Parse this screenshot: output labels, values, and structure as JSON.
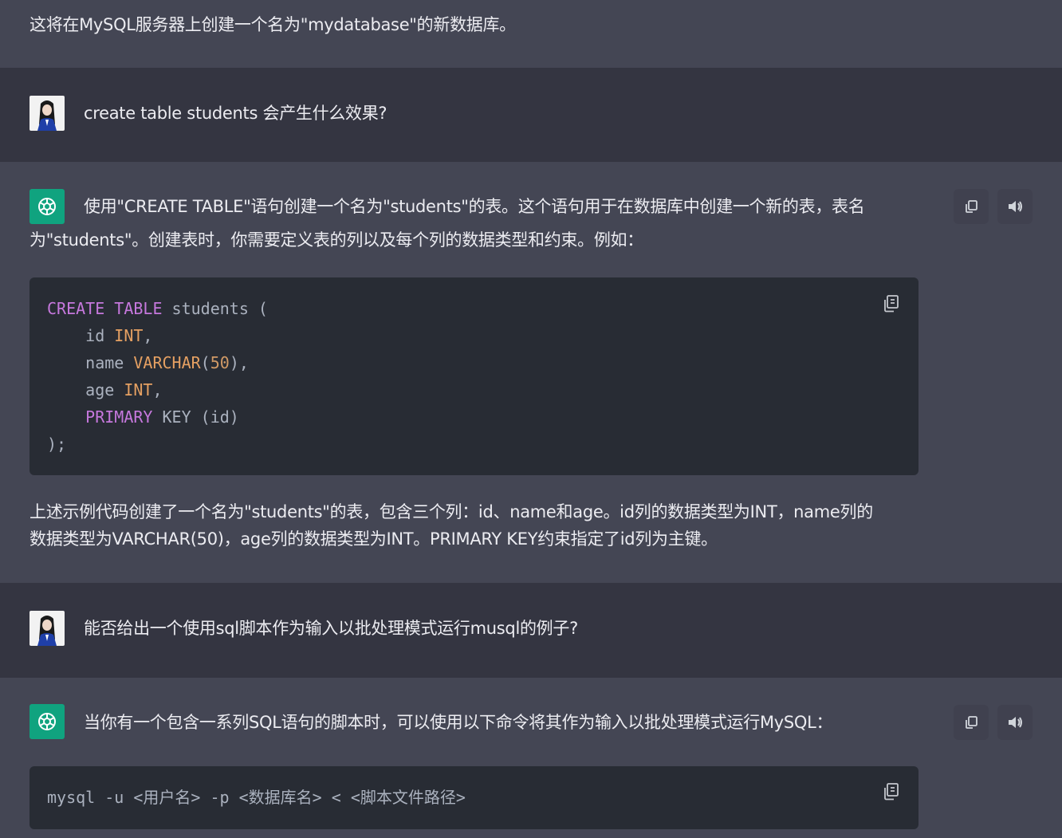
{
  "messages": {
    "m0": {
      "text": "这将在MySQL服务器上创建一个名为\"mydatabase\"的新数据库。"
    },
    "m1": {
      "text": "create table students 会产生什么效果?"
    },
    "m2": {
      "line1": "使用\"CREATE TABLE\"语句创建一个名为\"students\"的表。这个语句用于在数据库中创建一个新的表，表名",
      "line2": "为\"students\"。创建表时，你需要定义表的列以及每个列的数据类型和约束。例如：",
      "code": {
        "l1_kw1": "CREATE",
        "l1_kw2": "TABLE",
        "l1_rest": " students (",
        "l2_name": "    id ",
        "l2_type": "INT",
        "l2_end": ",",
        "l3_name": "    name ",
        "l3_type": "VARCHAR",
        "l3_open": "(",
        "l3_num": "50",
        "l3_end": "),",
        "l4_name": "    age ",
        "l4_type": "INT",
        "l4_end": ",",
        "l5_kw": "    PRIMARY",
        "l5_rest": " KEY (id)",
        "l6": ");"
      },
      "para1": "上述示例代码创建了一个名为\"students\"的表，包含三个列：id、name和age。id列的数据类型为INT，name列的",
      "para2": "数据类型为VARCHAR(50)，age列的数据类型为INT。PRIMARY KEY约束指定了id列为主键。"
    },
    "m3": {
      "text": "能否给出一个使用sql脚本作为输入以批处理模式运行musql的例子?"
    },
    "m4": {
      "text": "当你有一个包含一系列SQL语句的脚本时，可以使用以下命令将其作为输入以批处理模式运行MySQL：",
      "code": "mysql -u <用户名> -p <数据库名> < <脚本文件路径>"
    }
  },
  "icons": {
    "copy": "copy-icon",
    "speaker": "speaker-icon",
    "code_copy": "clipboard-icon",
    "assistant": "openai-logo-icon",
    "user": "user-avatar"
  },
  "colors": {
    "assistant_bg": "#444654",
    "user_bg": "#343541",
    "code_bg": "#282c34",
    "brand": "#10a37f",
    "keyword": "#c678dd",
    "type": "#e5a062"
  }
}
